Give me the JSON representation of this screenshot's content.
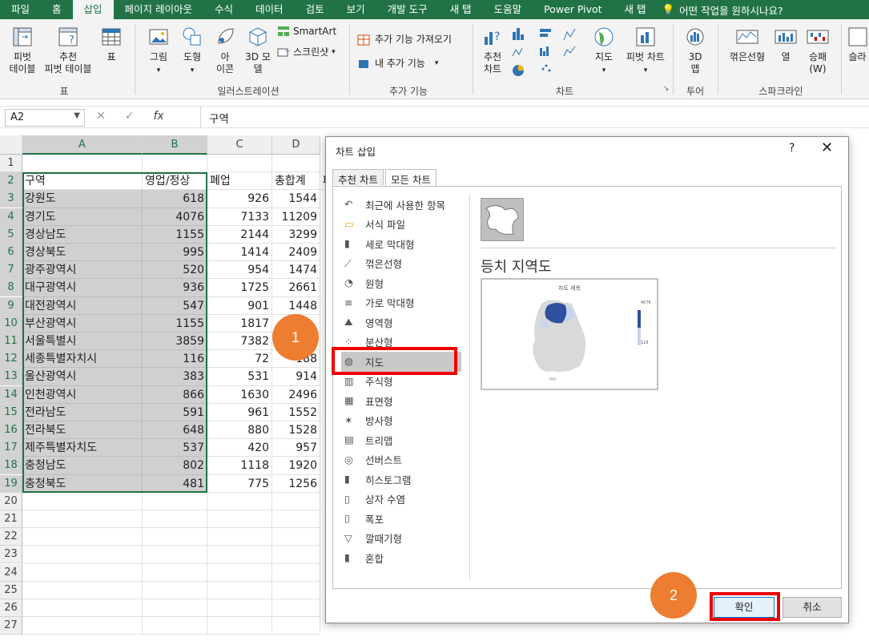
{
  "menu": {
    "tabs": [
      "파일",
      "홈",
      "삽입",
      "페이지 레이아웃",
      "수식",
      "데이터",
      "검토",
      "보기",
      "개발 도구",
      "새 탭",
      "도움말",
      "Power Pivot",
      "새 탭"
    ],
    "active_index": 2,
    "tellme": "어떤 작업을 원하시나요?"
  },
  "ribbon": {
    "pivot_table": "피벗\n테이블",
    "recommended_pivot": "추천\n피벗 테이블",
    "table": "표",
    "group_table": "표",
    "picture": "그림",
    "shapes": "도형",
    "icons": "아\n이콘",
    "models3d": "3D 모\n델",
    "smartart": "SmartArt",
    "screenshot": "스크린샷",
    "group_illustrations": "일러스트레이션",
    "get_addins": "추가 기능 가져오기",
    "my_addins": "내 추가 기능",
    "group_addins": "추가 기능",
    "recommended_charts": "추천\n차트",
    "maps": "지도",
    "pivot_chart": "피벗 차트",
    "group_charts": "차트",
    "map3d": "3D\n맵",
    "group_tours": "투어",
    "spark_line": "꺾은선형",
    "spark_column": "열",
    "spark_winloss": "승패\n(W)",
    "group_sparklines": "스파크라인",
    "slicer": "슬라"
  },
  "formula_bar": {
    "name_box": "A2",
    "formula": "구역"
  },
  "sheet": {
    "columns": [
      "A",
      "B",
      "C",
      "D"
    ],
    "rows": [
      {
        "n": "1",
        "a": "",
        "b": "",
        "c": "",
        "d": ""
      },
      {
        "n": "2",
        "a": "구역",
        "b": "영업/정상",
        "c": "폐업",
        "d": "총합계"
      },
      {
        "n": "3",
        "a": "강원도",
        "b": "618",
        "c": "926",
        "d": "1544"
      },
      {
        "n": "4",
        "a": "경기도",
        "b": "4076",
        "c": "7133",
        "d": "11209"
      },
      {
        "n": "5",
        "a": "경상남도",
        "b": "1155",
        "c": "2144",
        "d": "3299"
      },
      {
        "n": "6",
        "a": "경상북도",
        "b": "995",
        "c": "1414",
        "d": "2409"
      },
      {
        "n": "7",
        "a": "광주광역시",
        "b": "520",
        "c": "954",
        "d": "1474"
      },
      {
        "n": "8",
        "a": "대구광역시",
        "b": "936",
        "c": "1725",
        "d": "2661"
      },
      {
        "n": "9",
        "a": "대전광역시",
        "b": "547",
        "c": "901",
        "d": "1448"
      },
      {
        "n": "10",
        "a": "부산광역시",
        "b": "1155",
        "c": "1817",
        "d": ""
      },
      {
        "n": "11",
        "a": "서울특별시",
        "b": "3859",
        "c": "7382",
        "d": ""
      },
      {
        "n": "12",
        "a": "세종특별자치시",
        "b": "116",
        "c": "72",
        "d": "188"
      },
      {
        "n": "13",
        "a": "울산광역시",
        "b": "383",
        "c": "531",
        "d": "914"
      },
      {
        "n": "14",
        "a": "인천광역시",
        "b": "866",
        "c": "1630",
        "d": "2496"
      },
      {
        "n": "15",
        "a": "전라남도",
        "b": "591",
        "c": "961",
        "d": "1552"
      },
      {
        "n": "16",
        "a": "전라북도",
        "b": "648",
        "c": "880",
        "d": "1528"
      },
      {
        "n": "17",
        "a": "제주특별자치도",
        "b": "537",
        "c": "420",
        "d": "957"
      },
      {
        "n": "18",
        "a": "충청남도",
        "b": "802",
        "c": "1118",
        "d": "1920"
      },
      {
        "n": "19",
        "a": "충청북도",
        "b": "481",
        "c": "775",
        "d": "1256"
      },
      {
        "n": "20",
        "a": "",
        "b": "",
        "c": "",
        "d": ""
      },
      {
        "n": "21",
        "a": "",
        "b": "",
        "c": "",
        "d": ""
      },
      {
        "n": "22",
        "a": "",
        "b": "",
        "c": "",
        "d": ""
      },
      {
        "n": "23",
        "a": "",
        "b": "",
        "c": "",
        "d": ""
      },
      {
        "n": "24",
        "a": "",
        "b": "",
        "c": "",
        "d": ""
      },
      {
        "n": "25",
        "a": "",
        "b": "",
        "c": "",
        "d": ""
      },
      {
        "n": "26",
        "a": "",
        "b": "",
        "c": "",
        "d": ""
      },
      {
        "n": "27",
        "a": "",
        "b": "",
        "c": "",
        "d": ""
      }
    ],
    "partial_col_label": "폐"
  },
  "dialog": {
    "title": "차트 삽입",
    "help": "?",
    "close": "✕",
    "tabs": [
      "추천 차트",
      "모든 차트"
    ],
    "chart_types": [
      "최근에 사용한 항목",
      "서식 파일",
      "세로 막대형",
      "꺾은선형",
      "원형",
      "가로 막대형",
      "영역형",
      "분산형",
      "지도",
      "주식형",
      "표면형",
      "방사형",
      "트리맵",
      "선버스트",
      "히스토그램",
      "상자 수염",
      "폭포",
      "깔때기형",
      "혼합"
    ],
    "selected_type": "지도",
    "preview_title": "등치 지역도",
    "preview_chart_title": "차트 제목",
    "legend_max": "4076",
    "legend_min": "116",
    "ok": "확인",
    "cancel": "취소"
  },
  "annotations": {
    "step1": "1",
    "step2": "2"
  },
  "colors": {
    "excel_green": "#217346",
    "annotation_orange": "#ed7d31",
    "highlight_red": "#ee0000",
    "map_dark": "#2f4f9f",
    "map_light": "#c6d4ef"
  }
}
